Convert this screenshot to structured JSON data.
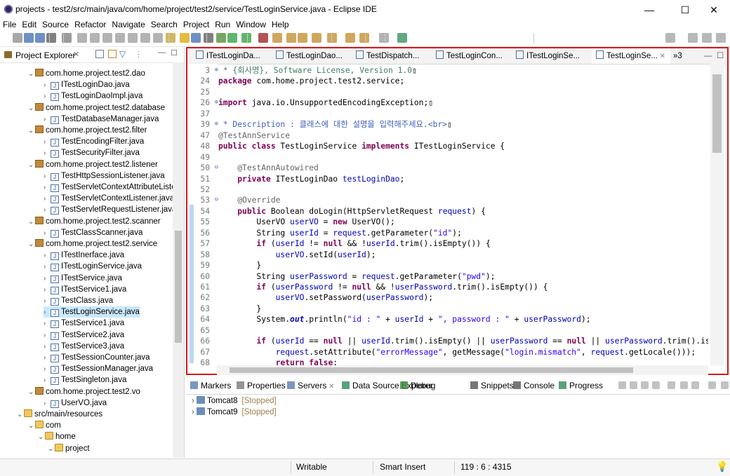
{
  "window": {
    "title": "projects - test2/src/main/java/com/home/project/test2/service/TestLoginService.java - Eclipse IDE",
    "minimize": "—",
    "maximize": "☐",
    "close": "✕"
  },
  "menu": [
    "File",
    "Edit",
    "Source",
    "Refactor",
    "Navigate",
    "Search",
    "Project",
    "Run",
    "Window",
    "Help"
  ],
  "explorer": {
    "title": "Project Explorer",
    "items": [
      {
        "label": "com.home.project.test2.dao",
        "kind": "package",
        "indent": 0
      },
      {
        "label": "ITestLoginDao.java",
        "kind": "java",
        "indent": 1
      },
      {
        "label": "TestLoginDaoImpl.java",
        "kind": "java",
        "indent": 1
      },
      {
        "label": "com.home.project.test2.database",
        "kind": "package",
        "indent": 0
      },
      {
        "label": "TestDatabaseManager.java",
        "kind": "java",
        "indent": 1
      },
      {
        "label": "com.home.project.test2.filter",
        "kind": "package",
        "indent": 0
      },
      {
        "label": "TestEncodingFilter.java",
        "kind": "java",
        "indent": 1
      },
      {
        "label": "TestSecurityFilter.java",
        "kind": "java",
        "indent": 1
      },
      {
        "label": "com.home.project.test2.listener",
        "kind": "package",
        "indent": 0
      },
      {
        "label": "TestHttpSessionListener.java",
        "kind": "java",
        "indent": 1
      },
      {
        "label": "TestServletContextAttributeListe",
        "kind": "java",
        "indent": 1
      },
      {
        "label": "TestServletContextListener.java",
        "kind": "java",
        "indent": 1
      },
      {
        "label": "TestServletRequestListener.java",
        "kind": "java",
        "indent": 1
      },
      {
        "label": "com.home.project.test2.scanner",
        "kind": "package",
        "indent": 0
      },
      {
        "label": "TestClassScanner.java",
        "kind": "java",
        "indent": 1
      },
      {
        "label": "com.home.project.test2.service",
        "kind": "package",
        "indent": 0
      },
      {
        "label": "ITestInerface.java",
        "kind": "java",
        "indent": 1
      },
      {
        "label": "ITestLoginService.java",
        "kind": "java",
        "indent": 1
      },
      {
        "label": "ITestService.java",
        "kind": "java",
        "indent": 1
      },
      {
        "label": "ITestService1.java",
        "kind": "java",
        "indent": 1
      },
      {
        "label": "TestClass.java",
        "kind": "java",
        "indent": 1
      },
      {
        "label": "TestLoginService.java",
        "kind": "java",
        "indent": 1,
        "selected": true
      },
      {
        "label": "TestService1.java",
        "kind": "java",
        "indent": 1
      },
      {
        "label": "TestService2.java",
        "kind": "java",
        "indent": 1
      },
      {
        "label": "TestService3.java",
        "kind": "java",
        "indent": 1
      },
      {
        "label": "TestSessionCounter.java",
        "kind": "java",
        "indent": 1
      },
      {
        "label": "TestSessionManager.java",
        "kind": "java",
        "indent": 1
      },
      {
        "label": "TestSingleton.java",
        "kind": "java",
        "indent": 1
      },
      {
        "label": "com.home.project.test2.vo",
        "kind": "package",
        "indent": 0
      },
      {
        "label": "UserVO.java",
        "kind": "java",
        "indent": 1
      },
      {
        "label": "src/main/resources",
        "kind": "srcfolder",
        "indent": -1
      },
      {
        "label": "com",
        "kind": "folder",
        "indent": 0
      },
      {
        "label": "home",
        "kind": "folder",
        "indent": 1
      },
      {
        "label": "project",
        "kind": "folder",
        "indent": 2
      }
    ]
  },
  "editor": {
    "tabs": [
      {
        "label": "ITestLoginDa..."
      },
      {
        "label": "TestLoginDao..."
      },
      {
        "label": "TestDispatch..."
      },
      {
        "label": "TestLoginCon..."
      },
      {
        "label": "ITestLoginSe..."
      },
      {
        "label": "TestLoginSe...",
        "active": true
      }
    ],
    "overflow": "»3",
    "lines": [
      {
        "n": "3",
        "fold": "⊕",
        "html": "<span class=\"cm\"> * {회사명}, Software License, Version 1.0</span>▯"
      },
      {
        "n": "24",
        "html": "<span class=\"kw\">package</span> com.home.project.test2.service;"
      },
      {
        "n": "25",
        "html": ""
      },
      {
        "n": "26",
        "fold": "⊕",
        "html": "<span class=\"kw\">import</span> java.io.UnsupportedEncodingException;▯"
      },
      {
        "n": "37",
        "html": ""
      },
      {
        "n": "39",
        "fold": "⊕",
        "html": "<span class=\"cd\"> * Description : 클래스에 대한 설명을 입력해주세요.&lt;br&gt;</span>▯"
      },
      {
        "n": "47",
        "html": "<span class=\"an\">@TestAnnService</span>"
      },
      {
        "n": "48",
        "html": "<span class=\"kw\">public class</span> TestLoginService <span class=\"kw\">implements</span> ITestLoginService {"
      },
      {
        "n": "49",
        "html": ""
      },
      {
        "n": "50",
        "fold": "⊖",
        "html": "    <span class=\"an\">@TestAnnAutowired</span>"
      },
      {
        "n": "51",
        "html": "    <span class=\"kw\">private</span> ITestLoginDao <span class=\"fd\">testLoginDao</span>;"
      },
      {
        "n": "52",
        "html": ""
      },
      {
        "n": "53",
        "fold": "⊖",
        "html": "    <span class=\"an\">@Override</span>"
      },
      {
        "n": "54",
        "html": "    <span class=\"kw\">public</span> Boolean doLogin(HttpServletRequest <span class=\"fd\">request</span>) {"
      },
      {
        "n": "55",
        "html": "        UserVO <span class=\"fd\">userVO</span> = <span class=\"kw\">new</span> UserVO();"
      },
      {
        "n": "56",
        "html": "        String <span class=\"fd\">userId</span> = <span class=\"fd\">request</span>.getParameter(<span class=\"st\">\"id\"</span>);"
      },
      {
        "n": "57",
        "html": "        <span class=\"kw\">if</span> (<span class=\"fd\">userId</span> != <span class=\"kw\">null</span> &amp;&amp; !<span class=\"fd\">userId</span>.trim().isEmpty()) {"
      },
      {
        "n": "58",
        "html": "            <span class=\"fd\">userVO</span>.setId(<span class=\"fd\">userId</span>);"
      },
      {
        "n": "59",
        "html": "        }"
      },
      {
        "n": "60",
        "html": "        String <span class=\"fd\">userPassword</span> = <span class=\"fd\">request</span>.getParameter(<span class=\"st\">\"pwd\"</span>);"
      },
      {
        "n": "61",
        "html": "        <span class=\"kw\">if</span> (<span class=\"fd\">userPassword</span> != <span class=\"kw\">null</span> &amp;&amp; !<span class=\"fd\">userPassword</span>.trim().isEmpty()) {"
      },
      {
        "n": "62",
        "html": "            <span class=\"fd\">userVO</span>.setPassword(<span class=\"fd\">userPassword</span>);"
      },
      {
        "n": "63",
        "html": "        }"
      },
      {
        "n": "64",
        "html": "        System.<span class=\"sf\">out</span>.println(<span class=\"st\">\"id : \"</span> + <span class=\"fd\">userId</span> + <span class=\"st\">\", password : \"</span> + <span class=\"fd\">userPassword</span>);"
      },
      {
        "n": "65",
        "html": ""
      },
      {
        "n": "66",
        "html": "        <span class=\"kw\">if</span> (<span class=\"fd\">userId</span> == <span class=\"kw\">null</span> || <span class=\"fd\">userId</span>.trim().isEmpty() || <span class=\"fd\">userPassword</span> == <span class=\"kw\">null</span> || <span class=\"fd\">userPassword</span>.trim().isEm"
      },
      {
        "n": "67",
        "html": "            <span class=\"fd\">request</span>.setAttribute(<span class=\"st\">\"errorMessage\"</span>, getMessage(<span class=\"st\">\"login.mismatch\"</span>, <span class=\"fd\">request</span>.getLocale()));"
      },
      {
        "n": "68",
        "html": "            <span class=\"kw\">return false</span>;"
      }
    ]
  },
  "bottom": {
    "tabs": [
      {
        "label": "Markers"
      },
      {
        "label": "Properties"
      },
      {
        "label": "Servers",
        "active": true
      },
      {
        "label": "Data Source Explorer"
      },
      {
        "label": "Debug"
      },
      {
        "label": "Snippets"
      },
      {
        "label": "Console"
      },
      {
        "label": "Progress"
      }
    ],
    "servers": [
      {
        "name": "Tomcat8",
        "state": "[Stopped]"
      },
      {
        "name": "Tomcat9",
        "state": "[Stopped]"
      }
    ]
  },
  "status": {
    "writable": "Writable",
    "insert": "Smart Insert",
    "position": "119 : 6 : 4315"
  },
  "colors": {
    "accent_border": "#d11a1a",
    "selection": "#cce8ff"
  }
}
